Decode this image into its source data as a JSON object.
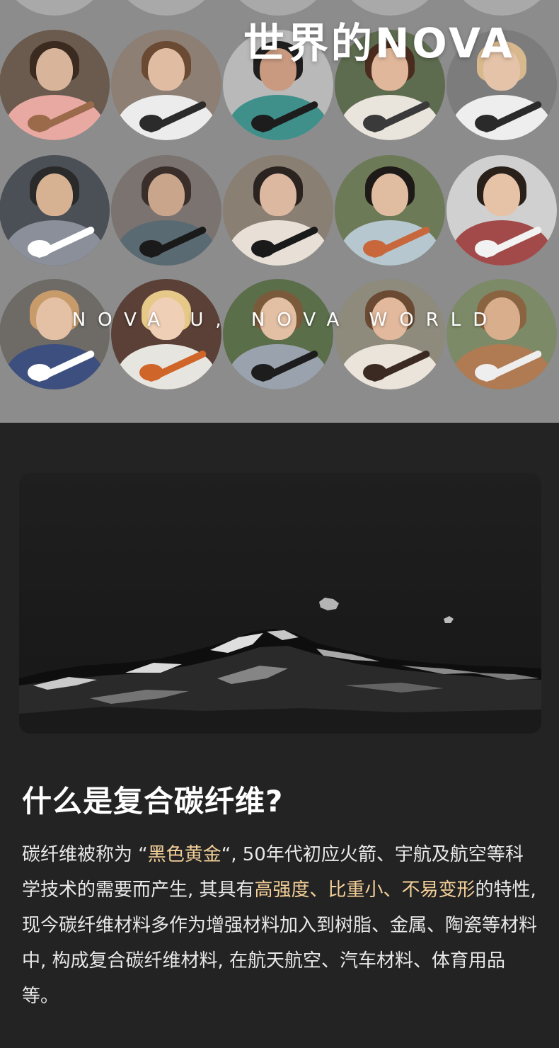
{
  "gallery": {
    "title": "世界的NOVA",
    "subtitle": "NOVA U, NOVA WORLD"
  },
  "section": {
    "title": "什么是复合碳纤维?",
    "paragraph": {
      "part1": "碳纤维被称为 “",
      "highlight1": "黑色黄金",
      "part2": "“, 50年代初应火箭、宇航及航空等科学技术的需要而产生, 其具有",
      "highlight2": "高强度、比重小、不易变形",
      "part3": "的特性, 现今碳纤维材料多作为增强材料加入到树脂、金属、陶瓷等材料中, 构成复合碳纤维材料, 在航天航空、汽车材料、体育用品等。"
    }
  },
  "colors": {
    "gallery_bg": "#8c8c8c",
    "page_bg": "#232323",
    "highlight": "#f3cf98"
  }
}
